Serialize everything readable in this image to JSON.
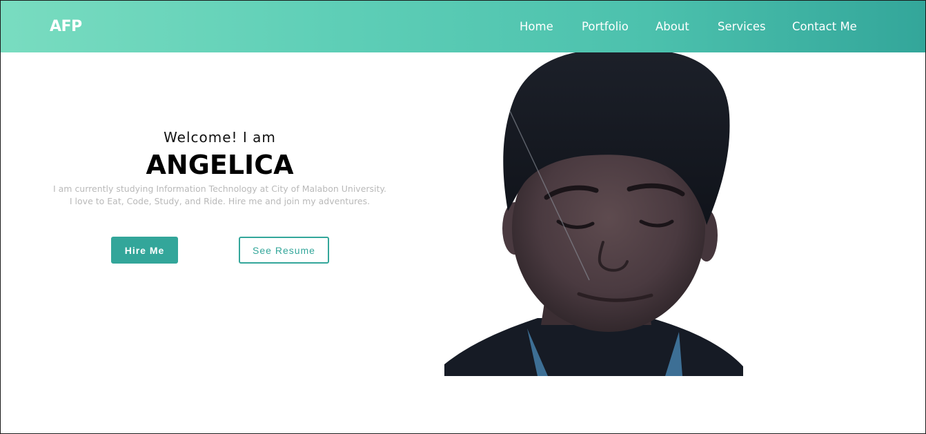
{
  "header": {
    "logo": "AFP",
    "nav": [
      "Home",
      "Portfolio",
      "About",
      "Services",
      "Contact Me"
    ]
  },
  "hero": {
    "greeting": "Welcome! I am",
    "name": "ANGELICA",
    "intro_line1": "I am currently studying Information Technology at City of Malabon University.",
    "intro_line2": "I love to Eat, Code, Study, and Ride. Hire me and join my adventures.",
    "hire_button": "Hire Me",
    "resume_button": "See Resume"
  },
  "colors": {
    "accent": "#33a69a",
    "header_start": "#79dcc0",
    "header_end": "#33a69a",
    "intro_text": "#b9b9b9"
  },
  "icons": {
    "portrait": "profile-photo"
  }
}
